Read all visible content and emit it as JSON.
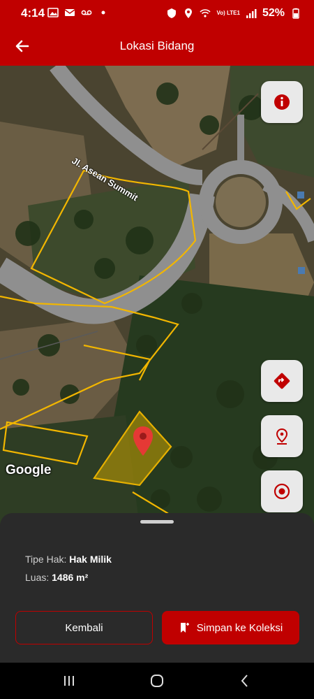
{
  "status_bar": {
    "time": "4:14",
    "battery_percent": "52%",
    "network_label": "Vo) LTE1"
  },
  "app_bar": {
    "title": "Lokasi Bidang",
    "back_icon": "arrow-left-icon"
  },
  "map": {
    "road_label": "Jl. Asean Summit",
    "attribution": "Google",
    "fab_buttons": [
      {
        "icon": "info-icon"
      },
      {
        "icon": "directions-icon"
      },
      {
        "icon": "location-pin-icon"
      },
      {
        "icon": "target-icon"
      }
    ],
    "marker_icon": "map-marker-icon",
    "parcel_color": "#f2b600",
    "accent_color": "#c00000"
  },
  "sheet": {
    "tipe_hak_label": "Tipe Hak:",
    "tipe_hak_value": "Hak Milik",
    "luas_label": "Luas:",
    "luas_value": "1486 m²",
    "back_button": "Kembali",
    "save_button": "Simpan ke Koleksi",
    "save_icon": "bookmark-add-icon"
  },
  "nav_bar": {
    "recents_icon": "recents-icon",
    "home_icon": "home-icon",
    "back_icon": "nav-back-icon"
  }
}
